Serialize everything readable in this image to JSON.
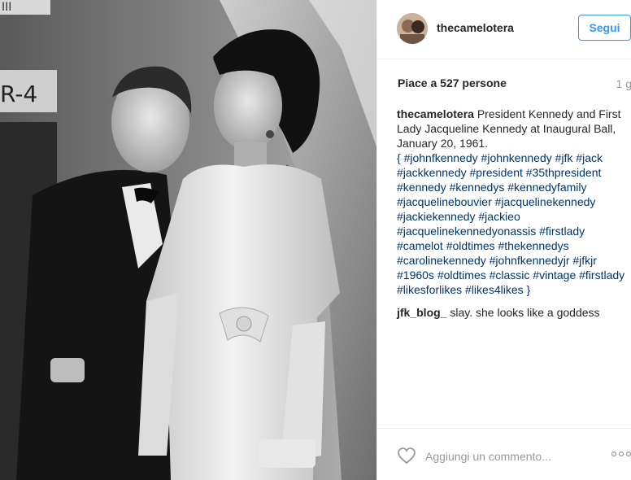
{
  "post": {
    "username": "thecamelotera",
    "follow_label": "Segui",
    "likes_text": "Piace a 527 persone",
    "timestamp": "1 g"
  },
  "comments": [
    {
      "author": "thecamelotera",
      "text_plain": "President Kennedy and First Lady Jacqueline Kennedy at Inaugural Ball, January 20, 1961.",
      "text_open": "{ ",
      "hashtags": "#johnfkennedy #johnkennedy #jfk #jack #jackkennedy #president #35thpresident #kennedy #kennedys #kennedyfamily #jacquelinebouvier #jacquelinekennedy #jackiekennedy #jackieo #jacquelinekennedyonassis #firstlady #camelot #oldtimes #thekennedys #carolinekennedy #johnfkennedyjr #jfkjr #1960s #oldtimes #classic #vintage #firstlady #likesforlikes #likes4likes",
      "text_close": " }"
    },
    {
      "author": "jfk_blog_",
      "text": "slay. she looks like a goddess"
    }
  ],
  "footer": {
    "add_comment_placeholder": "Aggiungi un commento...",
    "heart_icon": "heart-outline-icon",
    "more_icon": "more-options-icon"
  },
  "photo": {
    "sign_text_1": "III",
    "sign_text_2": "R-4"
  },
  "colors": {
    "link": "#003569",
    "accent": "#3897f0",
    "muted": "#999999"
  }
}
